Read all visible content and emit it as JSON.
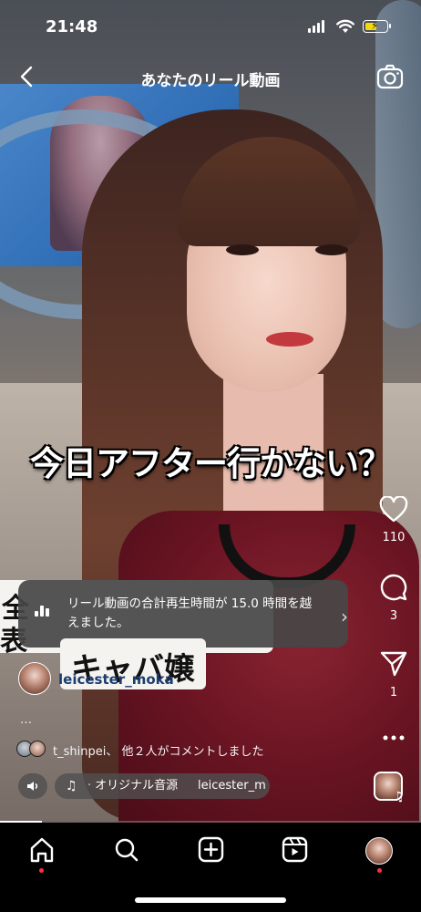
{
  "status_bar": {
    "time": "21:48"
  },
  "header": {
    "title": "あなたのリール動画"
  },
  "video": {
    "caption": "今日アフター行かない？",
    "tag1_chars": [
      "全",
      "表"
    ],
    "tag2": "キャバ嬢",
    "progress": 0.1
  },
  "toast": {
    "text": "リール動画の合計再生時間が 15.0 時間を越えました。"
  },
  "actions": {
    "likes": "110",
    "comments": "3",
    "shares": "1"
  },
  "author": {
    "username": "leicester_moka"
  },
  "more_caption": "…",
  "comment_summary": {
    "text": "t_shinpei、 他２人がコメントしました"
  },
  "audio": {
    "name": "オリジナル音源",
    "separator": "·",
    "user": "leicester_m"
  },
  "icons": {
    "back": "chevron-left-icon",
    "camera": "camera-icon",
    "like": "heart-icon",
    "comment": "comment-icon",
    "share": "send-icon",
    "more": "more-icon",
    "home": "home-icon",
    "search": "search-icon",
    "create": "plus-square-icon",
    "reels": "reels-icon",
    "profile": "profile-avatar"
  },
  "colors": {
    "battery": "#f5d90a",
    "notification_dot": "#ff3040"
  }
}
